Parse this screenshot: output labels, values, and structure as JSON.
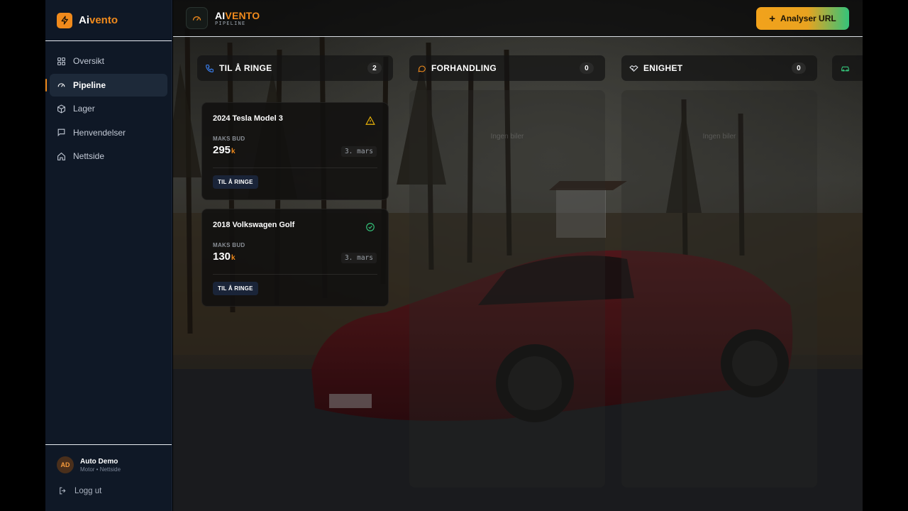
{
  "brand": {
    "name_part1": "Ai",
    "name_part2": "vento"
  },
  "sidebar": {
    "items": [
      {
        "label": "Oversikt",
        "icon": "grid-icon"
      },
      {
        "label": "Pipeline",
        "icon": "gauge-icon",
        "active": true
      },
      {
        "label": "Lager",
        "icon": "box-icon"
      },
      {
        "label": "Henvendelser",
        "icon": "message-icon"
      },
      {
        "label": "Nettside",
        "icon": "home-icon"
      }
    ],
    "user": {
      "initials": "AD",
      "name": "Auto Demo",
      "subtitle": "Motor • Nettside"
    },
    "logout_label": "Logg ut"
  },
  "topbar": {
    "title_part1": "AI",
    "title_part2": "VENTO",
    "subtitle": "PIPELINE",
    "analyze_label": "Analyser URL"
  },
  "columns": [
    {
      "title": "TIL Å RINGE",
      "count": "2",
      "icon": "phone-icon",
      "color": "#3b82f6"
    },
    {
      "title": "FORHANDLING",
      "count": "0",
      "icon": "chat-icon",
      "color": "#f08a1c",
      "empty_text": "Ingen biler"
    },
    {
      "title": "ENIGHET",
      "count": "0",
      "icon": "handshake-icon",
      "color": "#e6e9ef",
      "empty_text": "Ingen biler"
    }
  ],
  "cards": [
    {
      "title": "2024 Tesla Model 3",
      "label": "MAKS BUD",
      "value": "295",
      "unit": "k",
      "date": "3. mars",
      "badge": "TIL Å RINGE",
      "status_icon": "warning-icon"
    },
    {
      "title": "2018 Volkswagen Golf",
      "label": "MAKS BUD",
      "value": "130",
      "unit": "k",
      "date": "3. mars",
      "badge": "TIL Å RINGE",
      "status_icon": "check-circle-icon"
    }
  ],
  "colors": {
    "accent": "#f08a1c",
    "green": "#34c37a",
    "sidebar_bg": "#0f1826"
  }
}
